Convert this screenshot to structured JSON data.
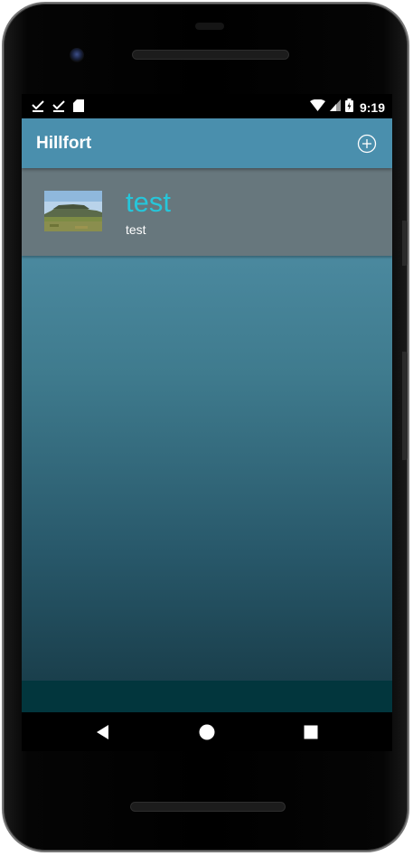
{
  "status_bar": {
    "time": "9:19",
    "left_icons": [
      "download-done-icon",
      "download-done-icon",
      "sd-card-icon"
    ],
    "right_icons": [
      "wifi-icon",
      "cell-signal-icon",
      "battery-charging-icon"
    ]
  },
  "app_bar": {
    "title": "Hillfort",
    "action_icon": "add-circle-icon",
    "color": "#4a8fad"
  },
  "list": {
    "items": [
      {
        "title": "test",
        "description": "test",
        "thumbnail": "landscape-photo"
      }
    ]
  },
  "nav_bar": {
    "buttons": [
      "back-icon",
      "home-icon",
      "recents-icon"
    ]
  },
  "colors": {
    "accent": "#26c6da",
    "item_background": "#67777d",
    "bottom_strip": "#02363d"
  }
}
